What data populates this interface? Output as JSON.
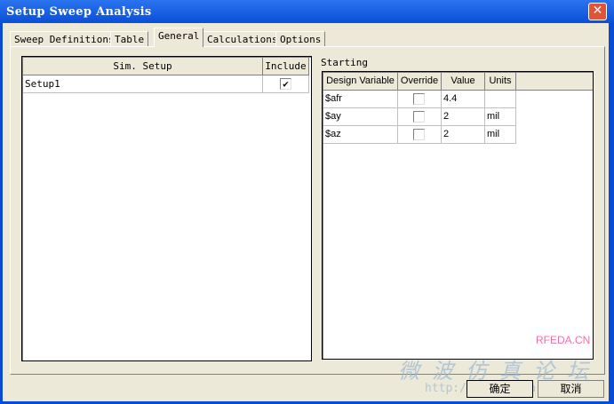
{
  "window": {
    "title": "Setup Sweep Analysis",
    "close_icon": "close-icon"
  },
  "tabs": [
    {
      "label": "Sweep Definitions"
    },
    {
      "label": "Table"
    },
    {
      "label": "General",
      "active": true
    },
    {
      "label": "Calculations"
    },
    {
      "label": "Options"
    }
  ],
  "sim_setup": {
    "headers": [
      "Sim. Setup",
      "Include"
    ],
    "rows": [
      {
        "name": "Setup1",
        "include": true
      }
    ]
  },
  "starting": {
    "label": "Starting",
    "headers": [
      "Design Variable",
      "Override",
      "Value",
      "Units"
    ],
    "rows": [
      {
        "variable": "$afr",
        "override": false,
        "value": "4.4",
        "units": ""
      },
      {
        "variable": "$ay",
        "override": false,
        "value": "2",
        "units": "mil"
      },
      {
        "variable": "$az",
        "override": false,
        "value": "2",
        "units": "mil"
      }
    ]
  },
  "buttons": {
    "ok": "确定",
    "cancel": "取消"
  },
  "watermark": {
    "brand": "RFEDA.CN",
    "forum": "微波仿真论坛",
    "url": "http://bbs.rfeda.cn"
  }
}
